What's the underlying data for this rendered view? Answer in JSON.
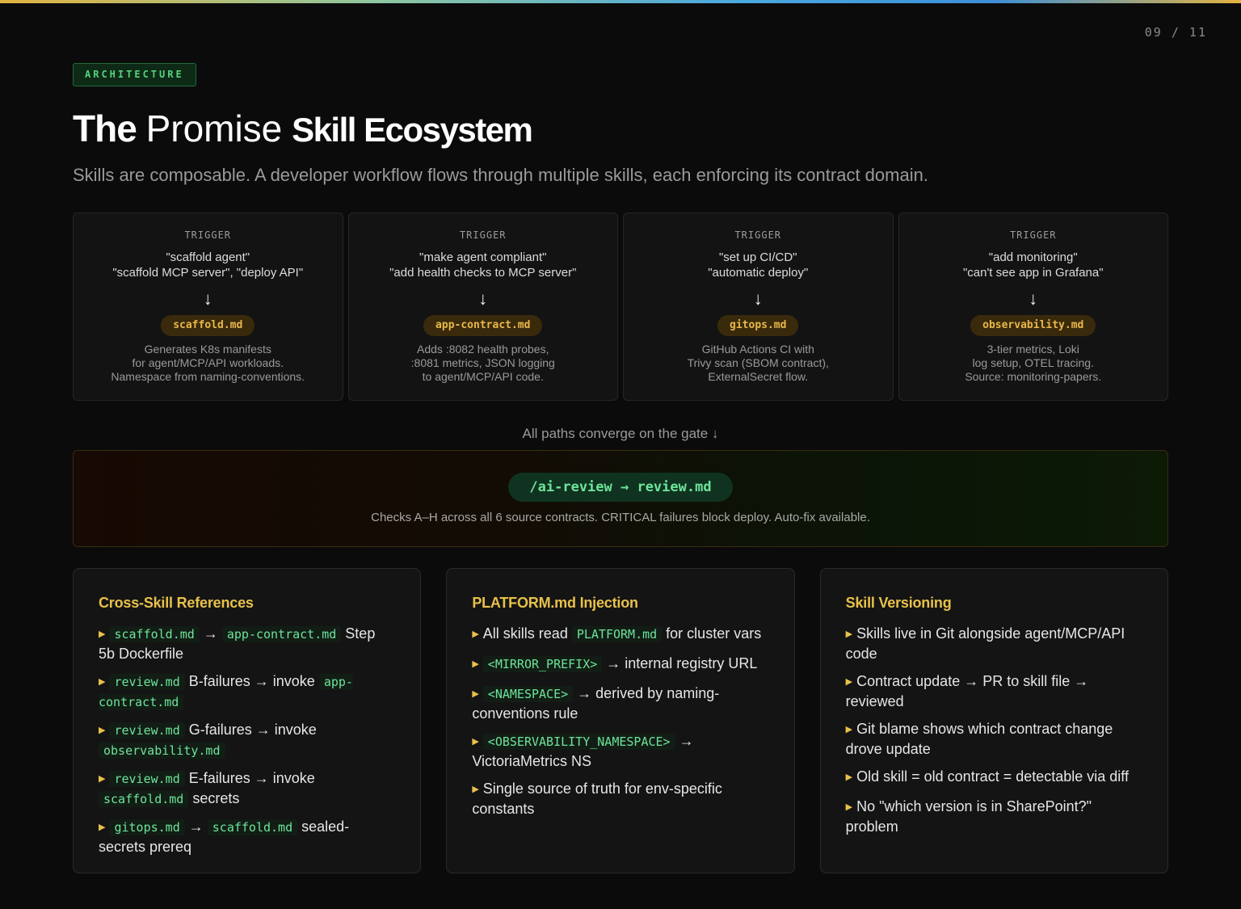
{
  "page_counter": "09 / 11",
  "section_tag": "ARCHITECTURE",
  "title": {
    "part1": "The",
    "part2": "Promise",
    "part3": "Skill Ecosystem"
  },
  "subtitle": "Skills are composable. A developer workflow flows through multiple skills, each enforcing its contract domain.",
  "triggers": [
    {
      "label": "TRIGGER",
      "line1": "\"scaffold agent\"",
      "line2": "\"scaffold MCP server\", \"deploy API\"",
      "skill": "scaffold.md",
      "desc1": "Generates K8s manifests",
      "desc2": "for agent/MCP/API workloads.",
      "desc3": "Namespace from naming-conventions."
    },
    {
      "label": "TRIGGER",
      "line1": "\"make agent compliant\"",
      "line2": "\"add health checks to MCP server\"",
      "skill": "app-contract.md",
      "desc1": "Adds :8082 health probes,",
      "desc2": ":8081 metrics, JSON logging",
      "desc3": "to agent/MCP/API code."
    },
    {
      "label": "TRIGGER",
      "line1": "\"set up CI/CD\"",
      "line2": "\"automatic deploy\"",
      "skill": "gitops.md",
      "desc1": "GitHub Actions CI with",
      "desc2": "Trivy scan (SBOM contract),",
      "desc3": "ExternalSecret flow."
    },
    {
      "label": "TRIGGER",
      "line1": "\"add monitoring\"",
      "line2": "\"can't see app in Grafana\"",
      "skill": "observability.md",
      "desc1": "3-tier metrics, Loki",
      "desc2": "log setup, OTEL tracing.",
      "desc3": "Source: monitoring-papers."
    }
  ],
  "arrow_glyph": "↓",
  "converge_label": "All paths converge on the gate ↓",
  "gate": {
    "command": "/ai-review → review.md",
    "description": "Checks A–H across all 6 source contracts. CRITICAL failures block deploy. Auto-fix available."
  },
  "cross_skill": {
    "title": "Cross-Skill References",
    "items": [
      {
        "c1": "scaffold.md",
        "t1": " → ",
        "c2": "app-contract.md",
        "t2": " Step 5b Dockerfile"
      },
      {
        "c1": "review.md",
        "t1": " B-failures → invoke ",
        "c2": "app-contract.md",
        "t2": ""
      },
      {
        "c1": "review.md",
        "t1": " G-failures → invoke ",
        "c2": "observability.md",
        "t2": ""
      },
      {
        "c1": "review.md",
        "t1": " E-failures → invoke ",
        "c2": "scaffold.md",
        "t2": " secrets"
      },
      {
        "c1": "gitops.md",
        "t1": " → ",
        "c2": "scaffold.md",
        "t2": " sealed-secrets prereq"
      }
    ]
  },
  "platform": {
    "title": "PLATFORM.md Injection",
    "item1": {
      "t1": "All skills read ",
      "c1": "PLATFORM.md",
      "t2": " for cluster vars"
    },
    "item2": {
      "c1": "<MIRROR_PREFIX>",
      "t1": " → internal registry URL"
    },
    "item3": {
      "c1": "<NAMESPACE>",
      "t1": " → derived by naming-conventions rule"
    },
    "item4": {
      "c1": "<OBSERVABILITY_NAMESPACE>",
      "t1": " → VictoriaMetrics NS"
    },
    "item5": {
      "t1": "Single source of truth for env-specific constants"
    }
  },
  "versioning": {
    "title": "Skill Versioning",
    "items": [
      "Skills live in Git alongside agent/MCP/API code",
      "Contract update → PR to skill file → reviewed",
      "Git blame shows which contract change drove update",
      "Old skill = old contract = detectable via diff",
      "No \"which version is in SharePoint?\" problem"
    ]
  },
  "bullet_glyph": "▶",
  "colors": {
    "accent_gold": "#e8c14a",
    "accent_green": "#6ee49a",
    "tag_green": "#56d27c",
    "background": "#0b0b0b"
  }
}
